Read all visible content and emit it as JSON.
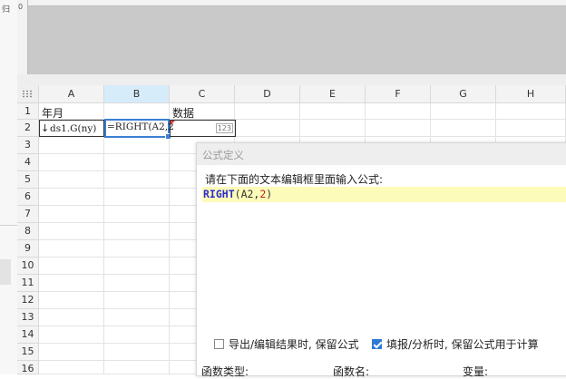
{
  "designer": {
    "ruler_zero": "0",
    "left_mark": "归"
  },
  "grid": {
    "columns": [
      "A",
      "B",
      "C",
      "D",
      "E",
      "F",
      "G",
      "H"
    ],
    "rows": [
      "1",
      "2",
      "3",
      "4",
      "5",
      "6",
      "7",
      "8",
      "9",
      "10",
      "11",
      "12",
      "13",
      "14",
      "15",
      "16"
    ],
    "selected_column": "B",
    "cells": {
      "A1": "年月",
      "C1": "数据",
      "A2_arrow": "↓",
      "A2": "ds1.G(ny)",
      "B2": "=RIGHT(A2,2",
      "C2_badge": "123"
    }
  },
  "dialog": {
    "title": "公式定义",
    "instruction": "请在下面的文本编辑框里面输入公式:",
    "formula": {
      "fn": "RIGHT",
      "open": "(",
      "ref": "A2,",
      "num": "2",
      "close": ")"
    },
    "option_keep_formula_export": {
      "label": "导出/编辑结果时, 保留公式",
      "checked": false
    },
    "option_keep_formula_fill": {
      "label": "填报/分析时, 保留公式用于计算",
      "checked": true
    },
    "function_type_label": "函数类型:",
    "function_name_label": "函数名:",
    "variable_label": "变量:"
  },
  "colors": {
    "selection": "#3a7fd5",
    "current_line": "#fdfbb9",
    "function_keyword": "#2b2bd1",
    "number_literal": "#c02020"
  }
}
